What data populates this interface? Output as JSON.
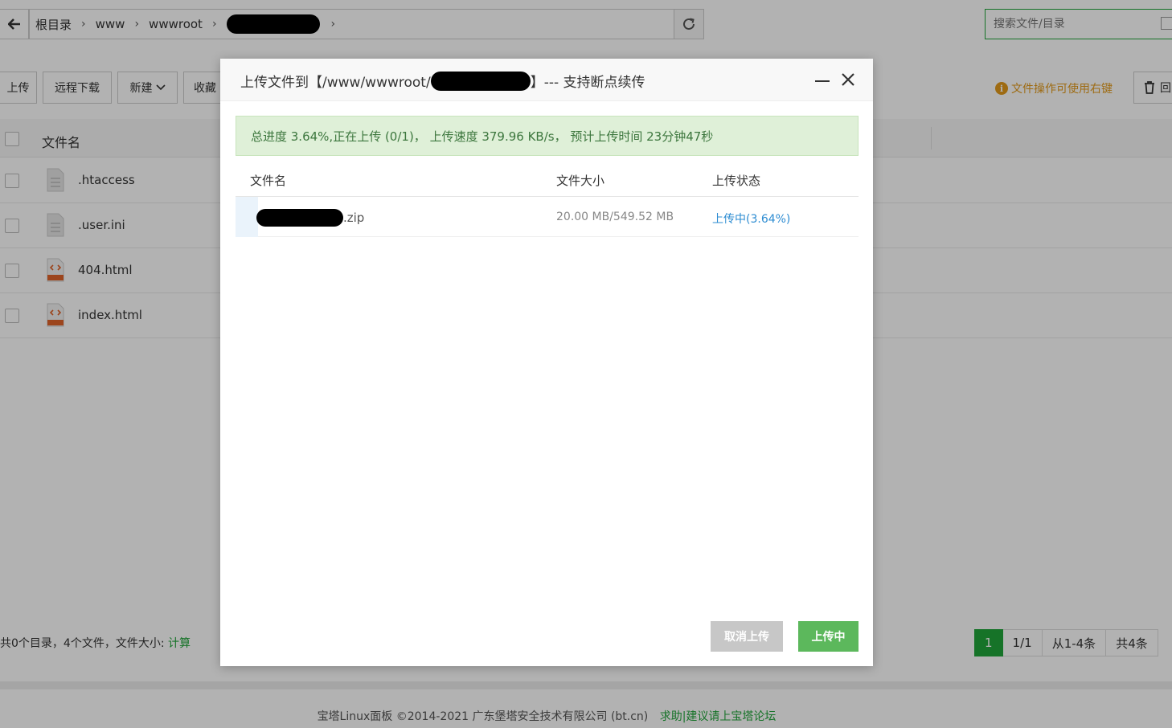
{
  "breadcrumb": {
    "items": [
      "根目录",
      "www",
      "wwwroot"
    ]
  },
  "search": {
    "placeholder": "搜索文件/目录"
  },
  "toolbar": {
    "upload": "上传",
    "remote_download": "远程下载",
    "new": "新建",
    "favorites": "收藏",
    "hint": "文件操作可使用右键",
    "trash": "回"
  },
  "file_table": {
    "header_name": "文件名",
    "rows": [
      {
        "name": ".htaccess",
        "icon": "text-file-icon"
      },
      {
        "name": ".user.ini",
        "icon": "text-file-icon"
      },
      {
        "name": "404.html",
        "icon": "html-file-icon"
      },
      {
        "name": "index.html",
        "icon": "html-file-icon"
      }
    ]
  },
  "footer": {
    "summary": "共0个目录，4个文件，文件大小:",
    "calc": "计算",
    "copyright": "宝塔Linux面板 ©2014-2021 广东堡塔安全技术有限公司 (bt.cn)",
    "link": "求助|建议请上宝塔论坛"
  },
  "pager": {
    "current": "1",
    "pages": "1/1",
    "range": "从1-4条",
    "total": "共4条"
  },
  "modal": {
    "title_prefix": "上传文件到【/www/wwwroot/",
    "title_suffix": "】--- 支持断点续传",
    "progress": "总进度 3.64%,正在上传 (0/1)，  上传速度 379.96 KB/s，  预计上传时间 23分钟47秒",
    "progress_fraction": 0.0364,
    "columns": [
      "文件名",
      "文件大小",
      "上传状态"
    ],
    "files": [
      {
        "name_suffix": ".zip",
        "size": "20.00 MB/549.52 MB",
        "status": "上传中(3.64%)"
      }
    ],
    "cancel_label": "取消上传",
    "uploading_label": "上传中"
  },
  "colors": {
    "brand_green": "#20a53a",
    "button_green": "#5cb85c",
    "status_blue": "#2d8cd2",
    "hint_orange": "#e29a1a",
    "progress_bg": "#dff0d8"
  }
}
